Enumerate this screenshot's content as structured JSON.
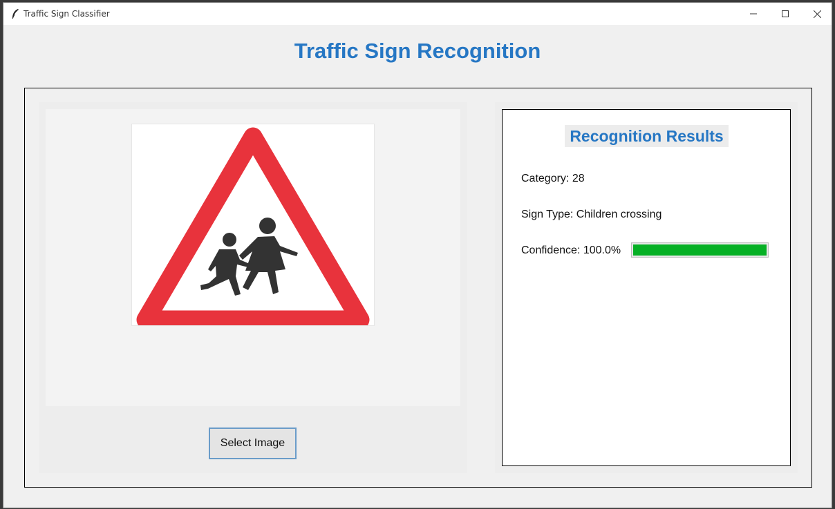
{
  "window": {
    "title": "Traffic Sign Classifier",
    "icon": "feather-icon"
  },
  "page_title": "Traffic Sign Recognition",
  "image_panel": {
    "image": "children-crossing-sign",
    "select_button_label": "Select Image"
  },
  "results": {
    "title": "Recognition Results",
    "category_label": "Category: 28",
    "sign_type_label": "Sign Type: Children crossing",
    "confidence_label": "Confidence: 100.0%",
    "confidence_value": 100.0
  },
  "colors": {
    "accent": "#2677c4",
    "progress": "#06b025",
    "sign_red": "#e8333c"
  }
}
